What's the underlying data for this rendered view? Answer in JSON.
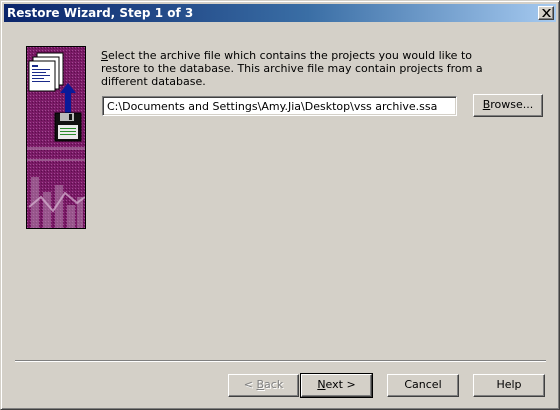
{
  "window": {
    "title": "Restore Wizard, Step 1 of 3"
  },
  "icons": {
    "close": "close-icon",
    "wizard_graphic": "restore-archive-graphic"
  },
  "description": {
    "line1_mnemonic": "S",
    "line1_rest": "elect the archive file which contains the projects you would like to",
    "line2": "restore to the database. This archive file may contain projects from a",
    "line3": "different database."
  },
  "archive_path": {
    "value": "C:\\Documents and Settings\\Amy.Jia\\Desktop\\vss archive.ssa"
  },
  "buttons": {
    "browse_mnemonic": "B",
    "browse_rest": "rowse...",
    "back_prefix": "< ",
    "back_mnemonic": "B",
    "back_rest": "ack",
    "next_mnemonic": "N",
    "next_rest": "ext >",
    "cancel": "Cancel",
    "help": "Help"
  },
  "colors": {
    "title_gradient_start": "#0a246a",
    "title_gradient_end": "#a6caf0",
    "face": "#d4d0c8",
    "graphic_background": "#7a1a66"
  }
}
